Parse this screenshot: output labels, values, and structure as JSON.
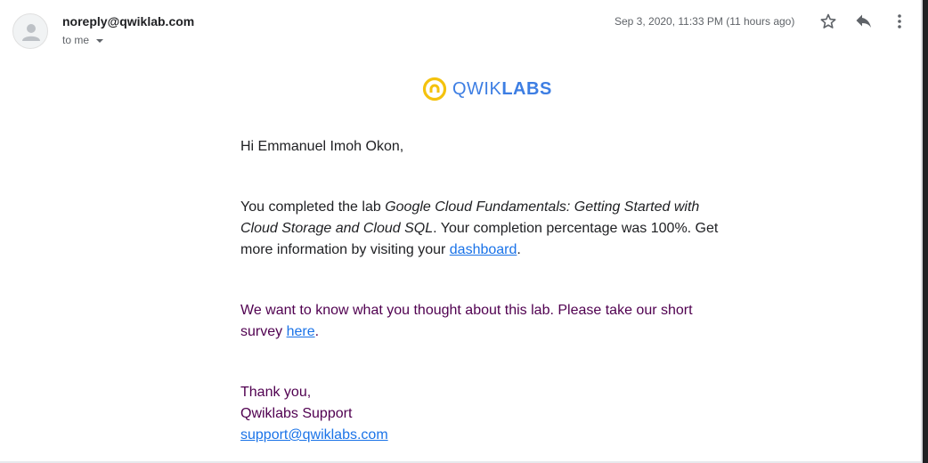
{
  "email": {
    "sender": "noreply@qwiklab.com",
    "recipient_label": "to me",
    "date": "Sep 3, 2020, 11:33 PM (11 hours ago)"
  },
  "icons": {
    "avatar": "person-icon",
    "star": "star-icon",
    "reply": "reply-icon",
    "more": "more-vert-icon",
    "logo": "qwiklabs-logo-icon"
  },
  "logo": {
    "text_light": "QWIK",
    "text_bold": "LABS",
    "ring_color": "#f4c20d",
    "text_color": "#3d7ee3"
  },
  "message": {
    "greeting": "Hi Emmanuel Imoh Okon,",
    "completion_prefix": "You completed the lab ",
    "lab_name": "Google Cloud Fundamentals: Getting Started with Cloud Storage and Cloud SQL",
    "completion_middle": ". Your completion percentage was 100%. Get more information by visiting your ",
    "dashboard_link": "dashboard",
    "completion_suffix": ".",
    "survey_prefix": "We want to know what you thought about this lab. Please take our short survey ",
    "survey_link": "here",
    "survey_suffix": ".",
    "thanks": "Thank you,",
    "signature": "Qwiklabs Support",
    "support_email": "support@qwiklabs.com"
  },
  "colors": {
    "link": "#1a73e8",
    "quoted_text": "#500050"
  }
}
